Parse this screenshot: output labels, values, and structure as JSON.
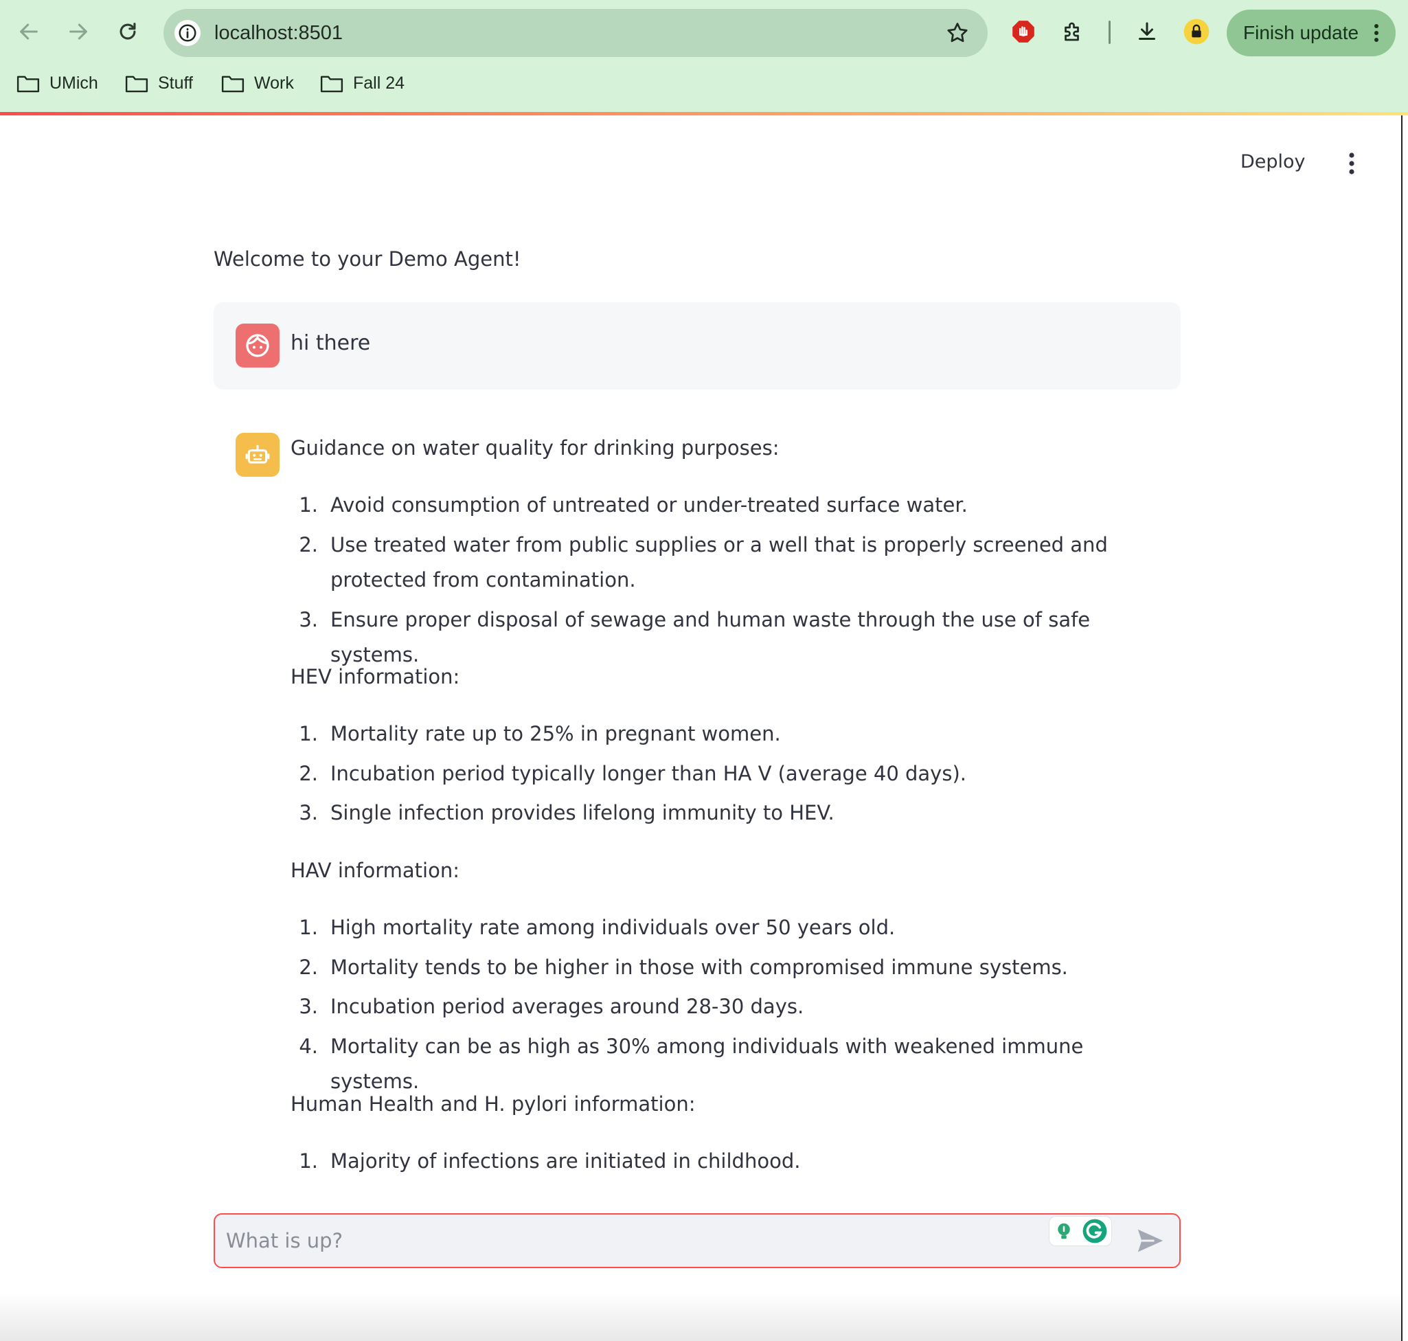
{
  "browser": {
    "url": "localhost:8501",
    "finish_update_label": "Finish update",
    "bookmarks": [
      "UMich",
      "Stuff",
      "Work",
      "Fall 24"
    ],
    "accent_color": "#d6f2d8"
  },
  "header": {
    "deploy_label": "Deploy"
  },
  "chat": {
    "welcome": "Welcome to your Demo Agent!",
    "user_message": "hi there",
    "bot": {
      "sections": [
        {
          "heading": "Guidance on water quality for drinking purposes:",
          "items": [
            "Avoid consumption of untreated or under-treated surface water.",
            "Use treated water from public supplies or a well that is properly screened and protected from contamination.",
            "Ensure proper disposal of sewage and human waste through the use of safe systems."
          ]
        },
        {
          "heading": "HEV information:",
          "items": [
            "Mortality rate up to 25% in pregnant women.",
            "Incubation period typically longer than HA V (average 40 days).",
            "Single infection provides lifelong immunity to HEV."
          ]
        },
        {
          "heading": "HAV information:",
          "items": [
            "High mortality rate among individuals over 50 years old.",
            "Mortality tends to be higher in those with compromised immune systems.",
            "Incubation period averages around 28-30 days.",
            "Mortality can be as high as 30% among individuals with weakened immune systems."
          ]
        },
        {
          "heading": "Human Health and H. pylori information:",
          "items": [
            "Majority of infections are initiated in childhood."
          ]
        }
      ]
    },
    "input_placeholder": "What is up?",
    "user_avatar_color": "#ee6f6f",
    "bot_avatar_color": "#f5bd4b",
    "input_border_color": "#ff4b4b"
  }
}
